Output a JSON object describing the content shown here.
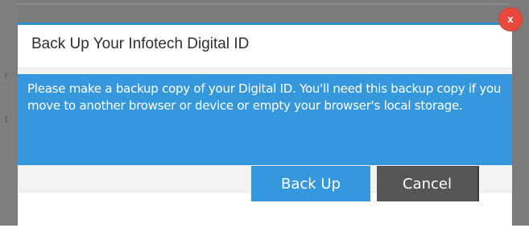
{
  "background": {
    "ghost_text_1": "r",
    "ghost_text_2": "t"
  },
  "dialog": {
    "title": "Back Up Your Infotech Digital ID",
    "close_label": "x",
    "notice_text": "Please make a backup copy of your Digital ID. You'll need this backup copy if you move to another browser or device or empty your browser's local storage.",
    "primary_button_label": "Back Up",
    "cancel_button_label": "Cancel"
  },
  "colors": {
    "accent": "#3598dc",
    "close": "#e7493c",
    "cancel": "#555555",
    "overlay": "#7b7b7b"
  }
}
